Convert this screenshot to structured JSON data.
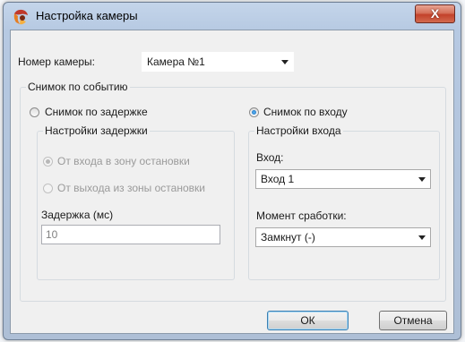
{
  "window": {
    "title": "Настройка камеры",
    "close_label": "X"
  },
  "camera": {
    "label": "Номер камеры:",
    "value": "Камера №1"
  },
  "event_group": {
    "title": "Снимок по событию",
    "mode_delay_label": "Снимок по задержке",
    "mode_input_label": "Снимок по входу",
    "selected_mode": "input"
  },
  "delay_settings": {
    "title": "Настройки задержки",
    "option_enter_label": "От входа в зону остановки",
    "option_exit_label": "От выхода из зоны остановки",
    "delay_label": "Задержка (мс)",
    "delay_value": "10"
  },
  "input_settings": {
    "title": "Настройки входа",
    "input_label": "Вход:",
    "input_value": "Вход 1",
    "trigger_label": "Момент сработки:",
    "trigger_value": "Замкнут (-)"
  },
  "buttons": {
    "ok": "ОК",
    "cancel": "Отмена"
  }
}
